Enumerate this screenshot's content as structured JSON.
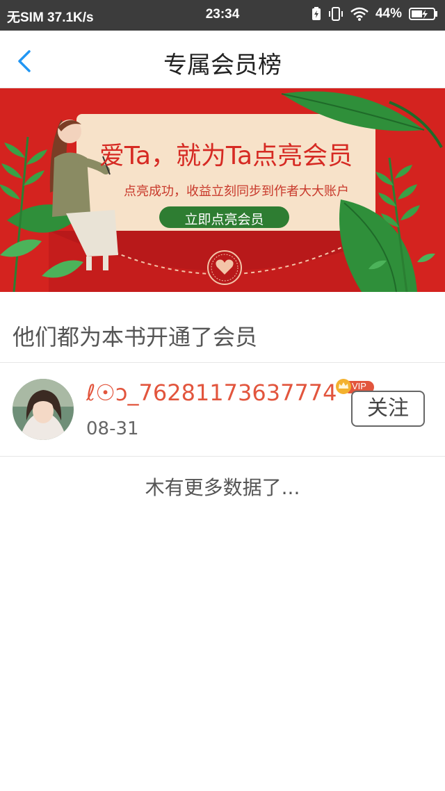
{
  "status_bar": {
    "carrier": "无SIM 37.1K/s",
    "time": "23:34",
    "battery": "44%"
  },
  "nav": {
    "title": "专属会员榜"
  },
  "banner": {
    "headline": "爱Ta，就为Ta点亮会员",
    "subline": "点亮成功，收益立刻同步到作者大大账户",
    "button_label": "立即点亮会员"
  },
  "section": {
    "title": "他们都为本书开通了会员"
  },
  "members": [
    {
      "name": "ℓ☉ɔ_76281173637774",
      "badge": "VIP",
      "date": "08-31",
      "follow_label": "关注"
    }
  ],
  "footer": {
    "no_more": "木有更多数据了..."
  },
  "colors": {
    "banner_red": "#d4231f",
    "name_red": "#e2553d",
    "back_blue": "#2196f3",
    "button_green": "#2e7d32"
  }
}
